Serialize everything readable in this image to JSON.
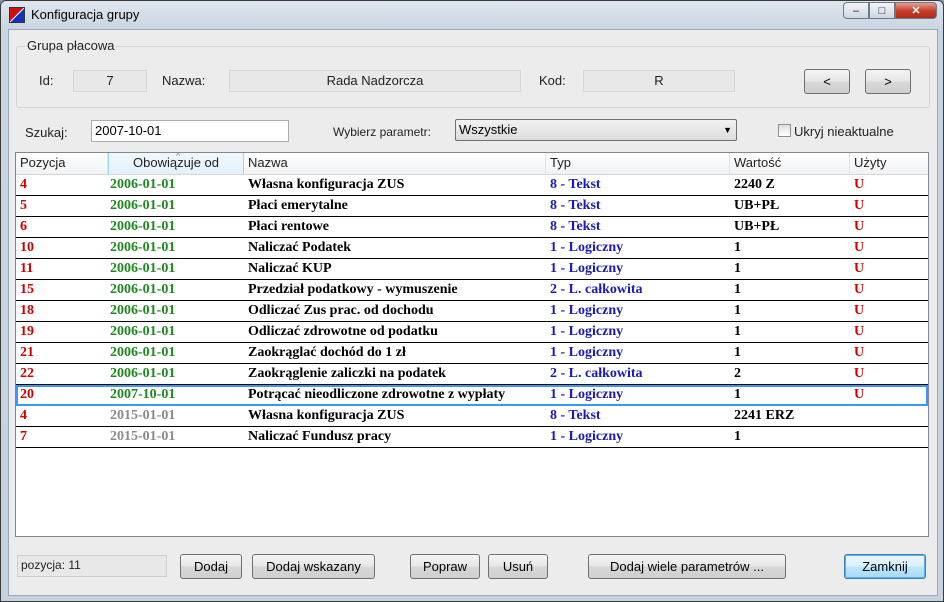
{
  "window": {
    "title": "Konfiguracja grupy",
    "buttons": {
      "minimize": "–",
      "maximize": "□",
      "close": "✕"
    },
    "colors": {
      "close_button": "#c8402c"
    }
  },
  "group": {
    "title": "Grupa płacowa",
    "id_label": "Id:",
    "id_value": "7",
    "name_label": "Nazwa:",
    "name_value": "Rada Nadzorcza",
    "code_label": "Kod:",
    "code_value": "R",
    "prev_label": "<",
    "next_label": ">"
  },
  "filter": {
    "search_label": "Szukaj:",
    "search_value": "2007-10-01",
    "param_label": "Wybierz parametr:",
    "param_value": "Wszystkie",
    "hide_label": "Ukryj nieaktualne",
    "hide_checked": false
  },
  "grid": {
    "columns": [
      "Pozycja",
      "Obowiązuje od",
      "Nazwa",
      "Typ",
      "Wartość",
      "Użyty"
    ],
    "sorted_column": "Obowiązuje od",
    "colors": {
      "position": "#d00000",
      "date_current": "#1e8a1e",
      "date_future": "#8a8a8a",
      "type": "#1a1ab8",
      "used": "#d00000",
      "selection": "#3399ff"
    },
    "rows": [
      {
        "poz": "4",
        "obo": "2006-01-01",
        "state": "current",
        "naz": "Własna konfiguracja ZUS",
        "typ": "8 - Tekst",
        "war": "2240 Z",
        "uzy": "U"
      },
      {
        "poz": "5",
        "obo": "2006-01-01",
        "state": "current",
        "naz": "Płaci emerytalne",
        "typ": "8 - Tekst",
        "war": "UB+PŁ",
        "uzy": "U"
      },
      {
        "poz": "6",
        "obo": "2006-01-01",
        "state": "current",
        "naz": "Płaci rentowe",
        "typ": "8 - Tekst",
        "war": "UB+PŁ",
        "uzy": "U"
      },
      {
        "poz": "10",
        "obo": "2006-01-01",
        "state": "current",
        "naz": "Naliczać Podatek",
        "typ": "1 - Logiczny",
        "war": "1",
        "uzy": "U"
      },
      {
        "poz": "11",
        "obo": "2006-01-01",
        "state": "current",
        "naz": "Naliczać KUP",
        "typ": "1 - Logiczny",
        "war": "1",
        "uzy": "U"
      },
      {
        "poz": "15",
        "obo": "2006-01-01",
        "state": "current",
        "naz": "Przedział podatkowy - wymuszenie",
        "typ": "2 - L. całkowita",
        "war": "1",
        "uzy": "U"
      },
      {
        "poz": "18",
        "obo": "2006-01-01",
        "state": "current",
        "naz": "Odliczać Zus prac. od dochodu",
        "typ": "1 - Logiczny",
        "war": "1",
        "uzy": "U"
      },
      {
        "poz": "19",
        "obo": "2006-01-01",
        "state": "current",
        "naz": "Odliczać zdrowotne od podatku",
        "typ": "1 - Logiczny",
        "war": "1",
        "uzy": "U"
      },
      {
        "poz": "21",
        "obo": "2006-01-01",
        "state": "current",
        "naz": "Zaokrąglać dochód do 1 zł",
        "typ": "1 - Logiczny",
        "war": "1",
        "uzy": "U"
      },
      {
        "poz": "22",
        "obo": "2006-01-01",
        "state": "current",
        "naz": "Zaokrąglenie zaliczki na podatek",
        "typ": "2 - L. całkowita",
        "war": "2",
        "uzy": "U"
      },
      {
        "poz": "20",
        "obo": "2007-10-01",
        "state": "current",
        "selected": true,
        "naz": "Potrącać nieodliczone zdrowotne z wypłaty",
        "typ": "1 - Logiczny",
        "war": "1",
        "uzy": "U"
      },
      {
        "poz": "4",
        "obo": "2015-01-01",
        "state": "future",
        "naz": "Własna konfiguracja ZUS",
        "typ": "8 - Tekst",
        "war": "2241 ERZ",
        "uzy": ""
      },
      {
        "poz": "7",
        "obo": "2015-01-01",
        "state": "future",
        "naz": "Naliczać Fundusz pracy",
        "typ": "1 - Logiczny",
        "war": "1",
        "uzy": ""
      }
    ]
  },
  "footer": {
    "status_text": "pozycja:  11",
    "add_label": "Dodaj",
    "add_pointed_label": "Dodaj wskazany",
    "edit_label": "Popraw",
    "delete_label": "Usuń",
    "add_many_label": "Dodaj wiele parametrów ...",
    "close_label": "Zamknij"
  }
}
